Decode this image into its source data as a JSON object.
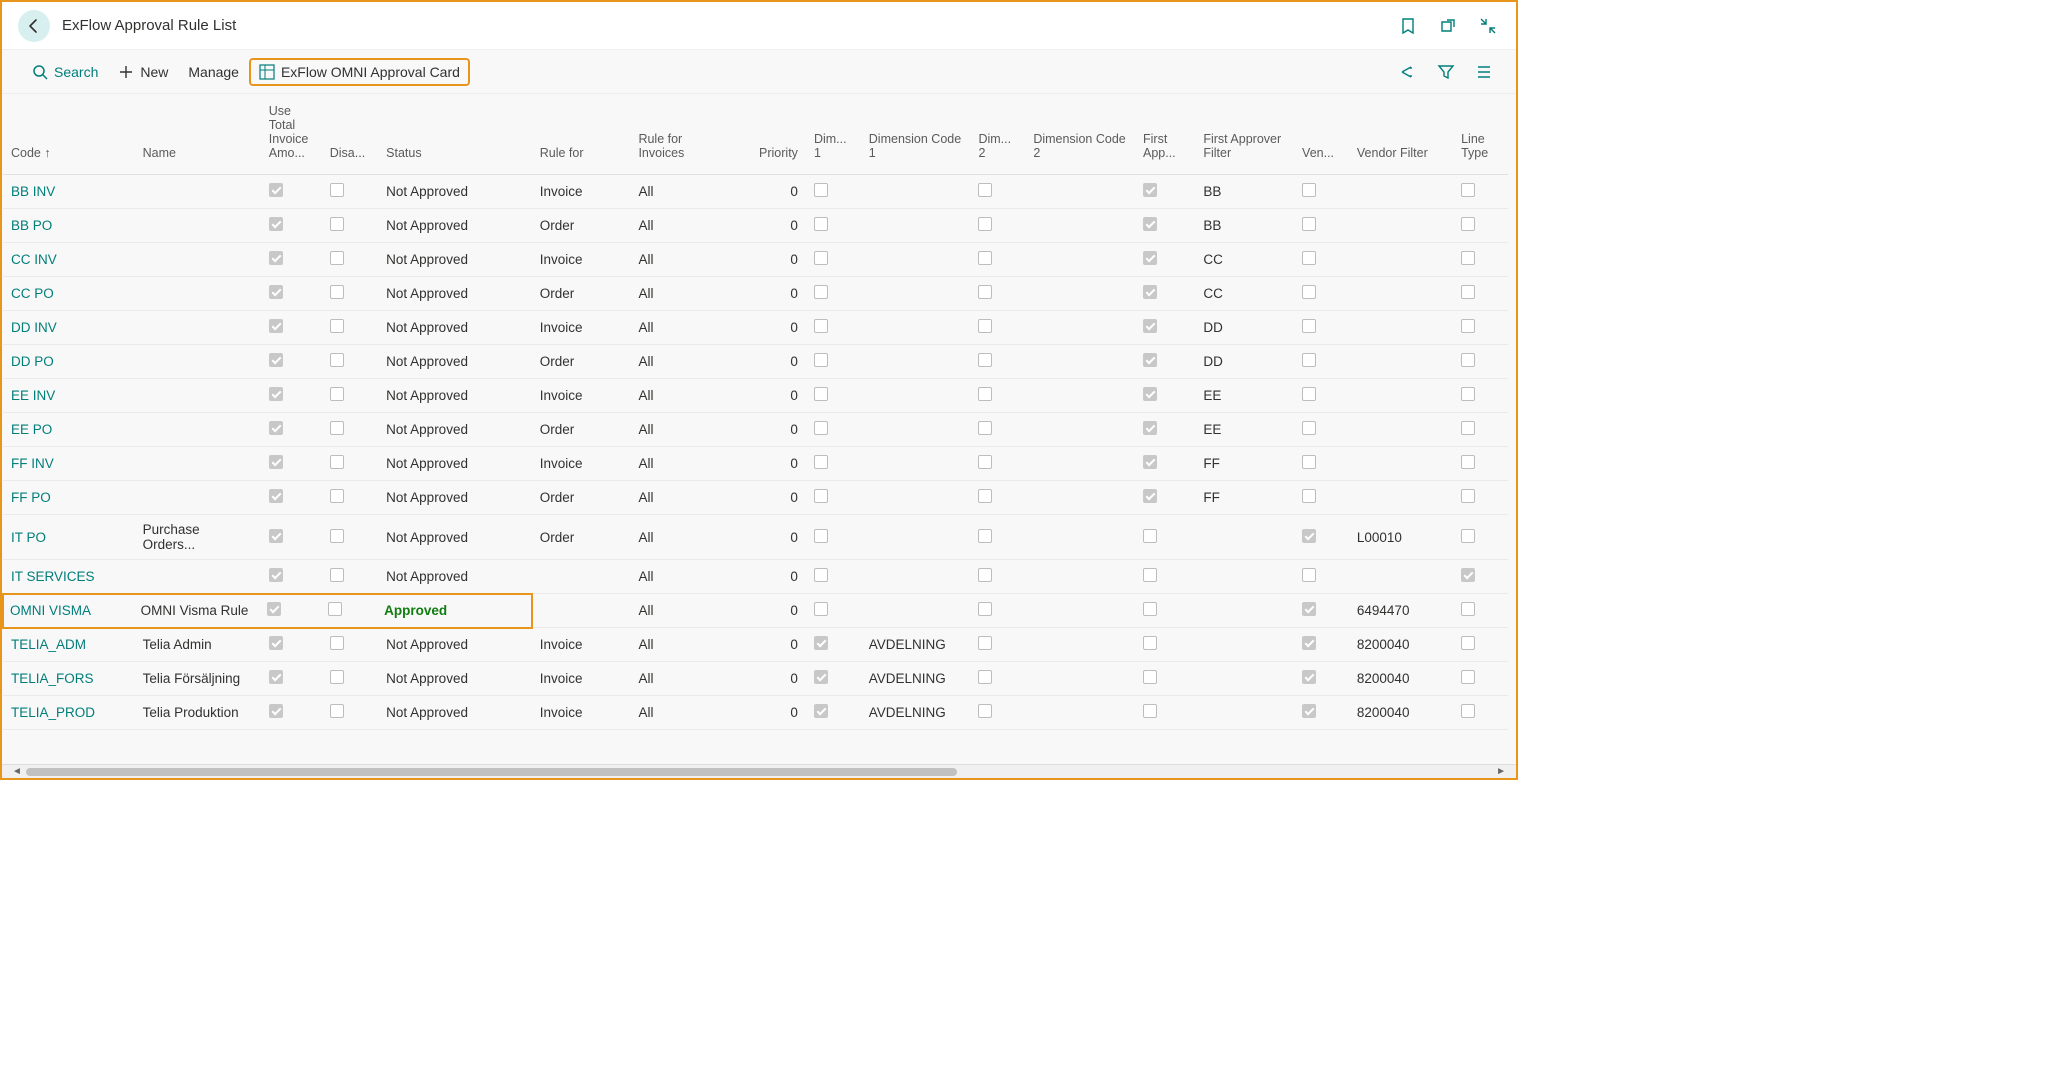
{
  "page": {
    "title": "ExFlow Approval Rule List"
  },
  "toolbar": {
    "search": "Search",
    "new": "New",
    "manage": "Manage",
    "omni": "ExFlow OMNI Approval Card"
  },
  "columns": {
    "code": "Code ↑",
    "name": "Name",
    "useTotal": "Use Total Invoice Amo...",
    "disabled": "Disa...",
    "status": "Status",
    "ruleFor": "Rule for",
    "ruleForInvoices": "Rule for Invoices",
    "priority": "Priority",
    "dim1": "Dim... 1",
    "dimCode1": "Dimension Code 1",
    "dim2": "Dim... 2",
    "dimCode2": "Dimension Code 2",
    "firstApp": "First App...",
    "firstAppFilter": "First Approver Filter",
    "ven": "Ven...",
    "vendorFilter": "Vendor Filter",
    "lineType": "Line Type"
  },
  "rows": [
    {
      "code": "BB INV",
      "name": "",
      "useTotal": true,
      "disabled": false,
      "status": "Not Approved",
      "ruleFor": "Invoice",
      "ruleForInvoices": "All",
      "priority": "0",
      "dim1": false,
      "dimCode1": "",
      "dim2": false,
      "dimCode2": "",
      "firstApp": true,
      "firstAppFilter": "BB",
      "ven": false,
      "vendorFilter": "",
      "lineType": false
    },
    {
      "code": "BB PO",
      "name": "",
      "useTotal": true,
      "disabled": false,
      "status": "Not Approved",
      "ruleFor": "Order",
      "ruleForInvoices": "All",
      "priority": "0",
      "dim1": false,
      "dimCode1": "",
      "dim2": false,
      "dimCode2": "",
      "firstApp": true,
      "firstAppFilter": "BB",
      "ven": false,
      "vendorFilter": "",
      "lineType": false
    },
    {
      "code": "CC INV",
      "name": "",
      "useTotal": true,
      "disabled": false,
      "status": "Not Approved",
      "ruleFor": "Invoice",
      "ruleForInvoices": "All",
      "priority": "0",
      "dim1": false,
      "dimCode1": "",
      "dim2": false,
      "dimCode2": "",
      "firstApp": true,
      "firstAppFilter": "CC",
      "ven": false,
      "vendorFilter": "",
      "lineType": false
    },
    {
      "code": "CC PO",
      "name": "",
      "useTotal": true,
      "disabled": false,
      "status": "Not Approved",
      "ruleFor": "Order",
      "ruleForInvoices": "All",
      "priority": "0",
      "dim1": false,
      "dimCode1": "",
      "dim2": false,
      "dimCode2": "",
      "firstApp": true,
      "firstAppFilter": "CC",
      "ven": false,
      "vendorFilter": "",
      "lineType": false
    },
    {
      "code": "DD INV",
      "name": "",
      "useTotal": true,
      "disabled": false,
      "status": "Not Approved",
      "ruleFor": "Invoice",
      "ruleForInvoices": "All",
      "priority": "0",
      "dim1": false,
      "dimCode1": "",
      "dim2": false,
      "dimCode2": "",
      "firstApp": true,
      "firstAppFilter": "DD",
      "ven": false,
      "vendorFilter": "",
      "lineType": false
    },
    {
      "code": "DD PO",
      "name": "",
      "useTotal": true,
      "disabled": false,
      "status": "Not Approved",
      "ruleFor": "Order",
      "ruleForInvoices": "All",
      "priority": "0",
      "dim1": false,
      "dimCode1": "",
      "dim2": false,
      "dimCode2": "",
      "firstApp": true,
      "firstAppFilter": "DD",
      "ven": false,
      "vendorFilter": "",
      "lineType": false
    },
    {
      "code": "EE INV",
      "name": "",
      "useTotal": true,
      "disabled": false,
      "status": "Not Approved",
      "ruleFor": "Invoice",
      "ruleForInvoices": "All",
      "priority": "0",
      "dim1": false,
      "dimCode1": "",
      "dim2": false,
      "dimCode2": "",
      "firstApp": true,
      "firstAppFilter": "EE",
      "ven": false,
      "vendorFilter": "",
      "lineType": false
    },
    {
      "code": "EE PO",
      "name": "",
      "useTotal": true,
      "disabled": false,
      "status": "Not Approved",
      "ruleFor": "Order",
      "ruleForInvoices": "All",
      "priority": "0",
      "dim1": false,
      "dimCode1": "",
      "dim2": false,
      "dimCode2": "",
      "firstApp": true,
      "firstAppFilter": "EE",
      "ven": false,
      "vendorFilter": "",
      "lineType": false
    },
    {
      "code": "FF INV",
      "name": "",
      "useTotal": true,
      "disabled": false,
      "status": "Not Approved",
      "ruleFor": "Invoice",
      "ruleForInvoices": "All",
      "priority": "0",
      "dim1": false,
      "dimCode1": "",
      "dim2": false,
      "dimCode2": "",
      "firstApp": true,
      "firstAppFilter": "FF",
      "ven": false,
      "vendorFilter": "",
      "lineType": false
    },
    {
      "code": "FF PO",
      "name": "",
      "useTotal": true,
      "disabled": false,
      "status": "Not Approved",
      "ruleFor": "Order",
      "ruleForInvoices": "All",
      "priority": "0",
      "dim1": false,
      "dimCode1": "",
      "dim2": false,
      "dimCode2": "",
      "firstApp": true,
      "firstAppFilter": "FF",
      "ven": false,
      "vendorFilter": "",
      "lineType": false
    },
    {
      "code": "IT PO",
      "name": "Purchase Orders...",
      "useTotal": true,
      "disabled": false,
      "status": "Not Approved",
      "ruleFor": "Order",
      "ruleForInvoices": "All",
      "priority": "0",
      "dim1": false,
      "dimCode1": "",
      "dim2": false,
      "dimCode2": "",
      "firstApp": false,
      "firstAppFilter": "",
      "ven": true,
      "vendorFilter": "L00010",
      "lineType": false
    },
    {
      "code": "IT SERVICES",
      "name": "",
      "useTotal": true,
      "disabled": false,
      "status": "Not Approved",
      "ruleFor": "",
      "ruleForInvoices": "All",
      "priority": "0",
      "dim1": false,
      "dimCode1": "",
      "dim2": false,
      "dimCode2": "",
      "firstApp": false,
      "firstAppFilter": "",
      "ven": false,
      "vendorFilter": "",
      "lineType": true
    },
    {
      "code": "OMNI VISMA",
      "name": "OMNI Visma Rule",
      "useTotal": true,
      "disabled": false,
      "status": "Approved",
      "ruleFor": "",
      "ruleForInvoices": "All",
      "priority": "0",
      "dim1": false,
      "dimCode1": "",
      "dim2": false,
      "dimCode2": "",
      "firstApp": false,
      "firstAppFilter": "",
      "ven": true,
      "vendorFilter": "6494470",
      "lineType": false,
      "highlighted": true
    },
    {
      "code": "TELIA_ADM",
      "name": "Telia Admin",
      "useTotal": true,
      "disabled": false,
      "status": "Not Approved",
      "ruleFor": "Invoice",
      "ruleForInvoices": "All",
      "priority": "0",
      "dim1": true,
      "dimCode1": "AVDELNING",
      "dim2": false,
      "dimCode2": "",
      "firstApp": false,
      "firstAppFilter": "",
      "ven": true,
      "vendorFilter": "8200040",
      "lineType": false
    },
    {
      "code": "TELIA_FORS",
      "name": "Telia Försäljning",
      "useTotal": true,
      "disabled": false,
      "status": "Not Approved",
      "ruleFor": "Invoice",
      "ruleForInvoices": "All",
      "priority": "0",
      "dim1": true,
      "dimCode1": "AVDELNING",
      "dim2": false,
      "dimCode2": "",
      "firstApp": false,
      "firstAppFilter": "",
      "ven": true,
      "vendorFilter": "8200040",
      "lineType": false
    },
    {
      "code": "TELIA_PROD",
      "name": "Telia Produktion",
      "useTotal": true,
      "disabled": false,
      "status": "Not Approved",
      "ruleFor": "Invoice",
      "ruleForInvoices": "All",
      "priority": "0",
      "dim1": true,
      "dimCode1": "AVDELNING",
      "dim2": false,
      "dimCode2": "",
      "firstApp": false,
      "firstAppFilter": "",
      "ven": true,
      "vendorFilter": "8200040",
      "lineType": false
    }
  ]
}
